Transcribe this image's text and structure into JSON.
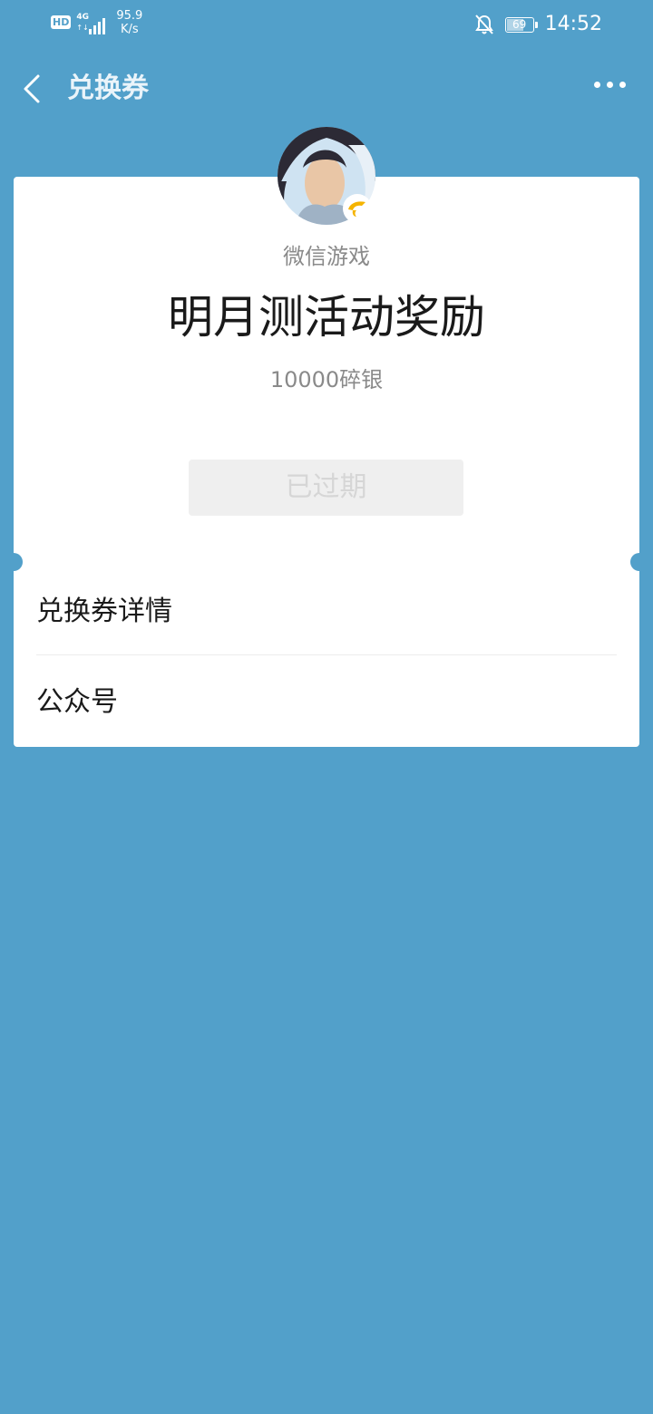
{
  "colors": {
    "background": "#52a0ca",
    "card": "#ffffff"
  },
  "status_bar": {
    "hd": "HD",
    "network_type": "4G",
    "network_arrows": "↑↓",
    "speed_value": "95.9",
    "speed_unit": "K/s",
    "battery_level": 69,
    "time": "14:52",
    "icons": [
      "hd-icon",
      "signal-icon",
      "bell-off-icon",
      "battery-icon"
    ]
  },
  "nav": {
    "title": "兑换券",
    "back_icon": "chevron-left-icon",
    "more_icon": "more-dots-icon"
  },
  "coupon": {
    "org_name": "微信游戏",
    "title": "明月测活动奖励",
    "value": "10000碎银",
    "button_label": "已过期"
  },
  "rows": [
    {
      "label": "兑换券详情"
    },
    {
      "label": "公众号"
    }
  ]
}
